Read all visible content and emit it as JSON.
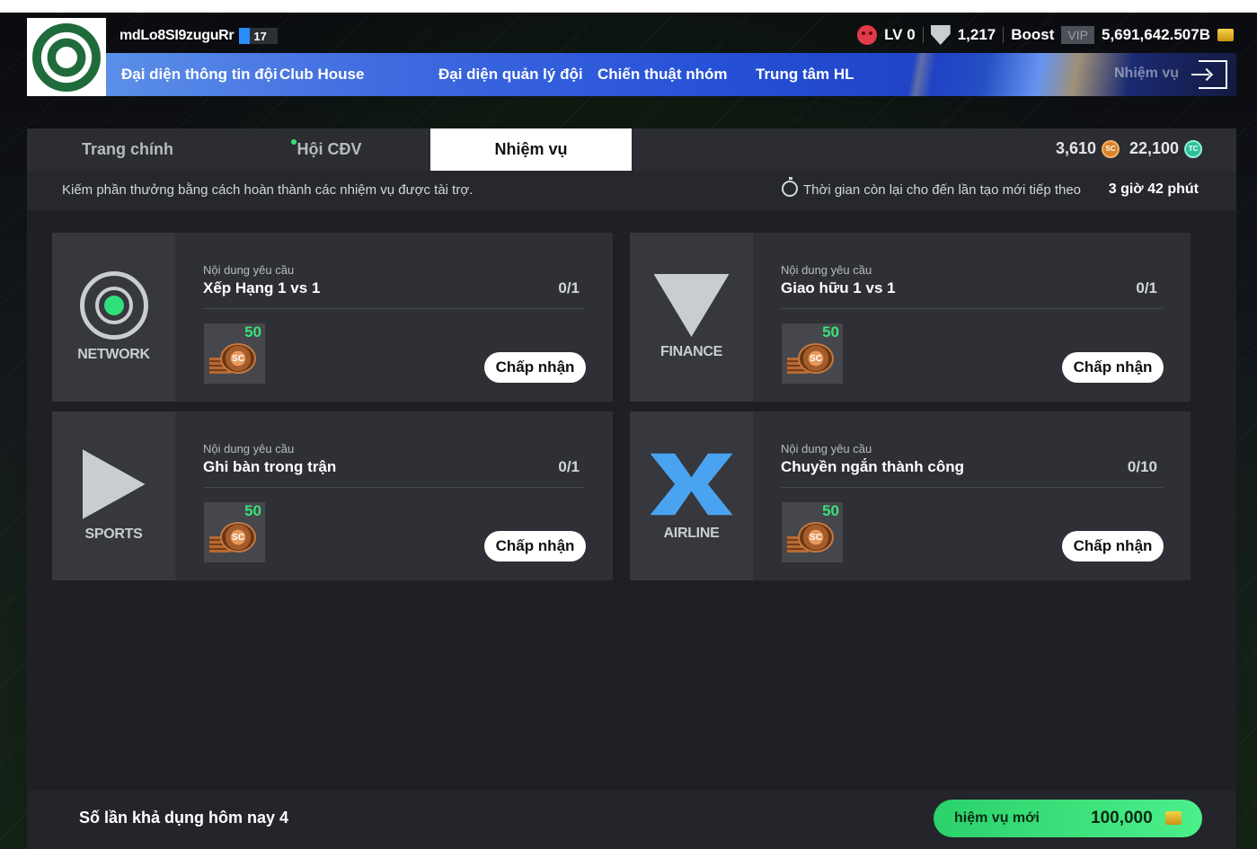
{
  "header": {
    "username": "mdLo8SI9zuguRr",
    "level_badge": "17",
    "stats": {
      "lv": "LV 0",
      "rank_points": "1,217",
      "boost_label": "Boost",
      "vip_label": "VIP",
      "balance": "5,691,642.507B"
    }
  },
  "nav": {
    "items": [
      "Đại diện thông tin đội",
      "Club House",
      "Đại diện quản lý đội",
      "Chiến thuật nhóm",
      "Trung tâm HL"
    ],
    "ghost": "Nhiệm vụ"
  },
  "tabs": {
    "items": [
      "Trang chính",
      "Hội CĐV",
      "Nhiệm vụ"
    ],
    "active": "Nhiệm vụ",
    "sc_amount": "3,610",
    "tc_amount": "22,100"
  },
  "info": {
    "description": "Kiếm phần thưởng bằng cách hoàn thành các nhiệm vụ được tài trợ.",
    "timer_label": "Thời gian còn lại cho đến lần tạo mới tiếp theo",
    "timer_value": "3 giờ 42 phút"
  },
  "missions": [
    {
      "sponsor": "NETWORK",
      "req_label": "Nội dung yêu cầu",
      "name": "Xếp Hạng 1 vs 1",
      "progress": "0/1",
      "reward": "50",
      "accept": "Chấp nhận"
    },
    {
      "sponsor": "FINANCE",
      "req_label": "Nội dung yêu cầu",
      "name": "Giao hữu 1 vs 1",
      "progress": "0/1",
      "reward": "50",
      "accept": "Chấp nhận"
    },
    {
      "sponsor": "SPORTS",
      "req_label": "Nội dung yêu cầu",
      "name": "Ghi bàn trong trận",
      "progress": "0/1",
      "reward": "50",
      "accept": "Chấp nhận"
    },
    {
      "sponsor": "AIRLINE",
      "req_label": "Nội dung yêu cầu",
      "name": "Chuyền ngắn thành công",
      "progress": "0/10",
      "reward": "50",
      "accept": "Chấp nhận"
    }
  ],
  "bottom": {
    "uses_today": "Số lần khả dụng hôm nay 4",
    "new_mission_label": "hiệm vụ mới",
    "new_mission_cost": "100,000"
  },
  "colors": {
    "accent_green": "#3ee07a",
    "nav_blue": "#2550d6",
    "panel_bg": "#1e2024"
  }
}
